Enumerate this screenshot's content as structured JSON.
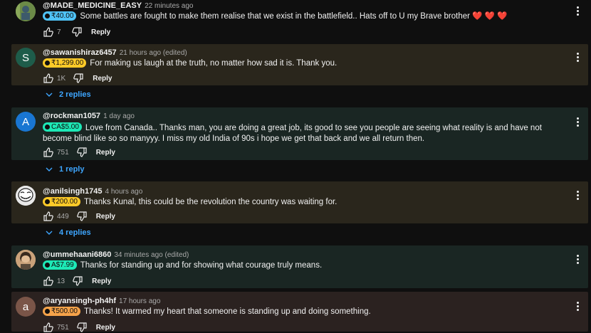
{
  "comments": [
    {
      "author": "@MADE_MEDICINE_EASY",
      "time": "22 minutes ago",
      "amount": "₹40.00",
      "chip_color": "#4fc3f7",
      "text": "Some battles are fought to make them realise that we exist in the battlefield.. Hats off to U my Brave brother ❤️ ❤️ ❤️",
      "likes": "7",
      "reply_label": "Reply",
      "bg": "#0f0f0f"
    },
    {
      "author": "@sawanishiraz6457",
      "time": "21 hours ago (edited)",
      "amount": "₹1,299.00",
      "chip_color": "#ffca28",
      "text": "For making us laugh at the truth, no matter how sad it is. Thank you.",
      "likes": "1K",
      "reply_label": "Reply",
      "avatar_letter": "S",
      "avatar_color": "#1e5c4a",
      "replies": "2 replies",
      "bg": "#2a261c"
    },
    {
      "author": "@rockman1057",
      "time": "1 day ago",
      "amount": "CA$5.00",
      "chip_color": "#1de9b6",
      "text": "Love from Canada.. Thanks man, you are doing a great job, its good to see you people are seeing what reality is and have not become blind like so so manyyy. I miss my old India of 90s i hope we get that back and we all return then.",
      "likes": "751",
      "reply_label": "Reply",
      "avatar_letter": "A",
      "avatar_color": "#1976d2",
      "replies": "1 reply",
      "bg": "#1a2623"
    },
    {
      "author": "@anilsingh1745",
      "time": "4 hours ago",
      "amount": "₹200.00",
      "chip_color": "#ffca28",
      "text": "Thanks Kunal, this could be the revolution the country was waiting for.",
      "likes": "449",
      "reply_label": "Reply",
      "replies": "4 replies",
      "bg": "#2a261c"
    },
    {
      "author": "@ummehaani6860",
      "time": "34 minutes ago (edited)",
      "amount": "A$7.99",
      "chip_color": "#1de9b6",
      "text": "Thanks for standing up and for showing what courage truly means.",
      "likes": "13",
      "reply_label": "Reply",
      "bg": "#1a2623"
    },
    {
      "author": "@aryansingh-ph4hf",
      "time": "17 hours ago",
      "amount": "₹500.00",
      "chip_color": "#f5a34a",
      "text": "Thanks! It warmed my heart that someone is standing up and doing something.",
      "likes": "751",
      "reply_label": "Reply",
      "avatar_letter": "a",
      "avatar_color": "#7a5548",
      "bg": "#2b2220"
    }
  ]
}
